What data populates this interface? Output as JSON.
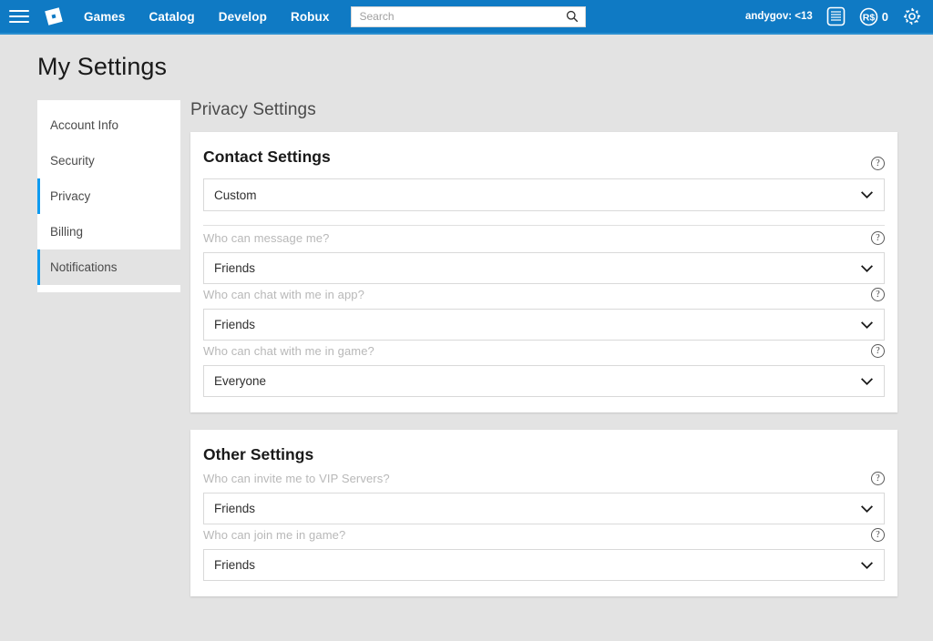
{
  "navbar": {
    "menu_icon": "hamburger-icon",
    "logo_icon": "roblox-logo-icon",
    "links": [
      {
        "label": "Games"
      },
      {
        "label": "Catalog"
      },
      {
        "label": "Develop"
      },
      {
        "label": "Robux"
      }
    ],
    "search": {
      "value": "",
      "placeholder": "Search",
      "icon": "search-icon"
    },
    "username": "andygov: <13",
    "messages_icon": "messages-icon",
    "robux_icon": "robux-icon",
    "robux_count": "0",
    "settings_icon": "gear-icon",
    "background_color": "#0f7ac4"
  },
  "page": {
    "title": "My Settings"
  },
  "sidebar": {
    "items": [
      {
        "label": "Account Info",
        "state": "default"
      },
      {
        "label": "Security",
        "state": "default"
      },
      {
        "label": "Privacy",
        "state": "active"
      },
      {
        "label": "Billing",
        "state": "default"
      },
      {
        "label": "Notifications",
        "state": "hover"
      }
    ],
    "active_indicator_color": "#0f9bf0"
  },
  "content": {
    "title": "Privacy Settings",
    "cards": [
      {
        "title": "Contact Settings",
        "help_icon": "help-circle-icon",
        "primary_select": {
          "value": "Custom",
          "chevron_icon": "chevron-down-icon"
        },
        "fields": [
          {
            "label": "Who can message me?",
            "value": "Friends",
            "help_icon": "help-circle-icon",
            "chevron_icon": "chevron-down-icon"
          },
          {
            "label": "Who can chat with me in app?",
            "value": "Friends",
            "help_icon": "help-circle-icon",
            "chevron_icon": "chevron-down-icon"
          },
          {
            "label": "Who can chat with me in game?",
            "value": "Everyone",
            "help_icon": "help-circle-icon",
            "chevron_icon": "chevron-down-icon"
          }
        ]
      },
      {
        "title": "Other Settings",
        "fields": [
          {
            "label": "Who can invite me to VIP Servers?",
            "value": "Friends",
            "help_icon": "help-circle-icon",
            "chevron_icon": "chevron-down-icon"
          },
          {
            "label": "Who can join me in game?",
            "value": "Friends",
            "help_icon": "help-circle-icon",
            "chevron_icon": "chevron-down-icon"
          }
        ]
      }
    ]
  }
}
